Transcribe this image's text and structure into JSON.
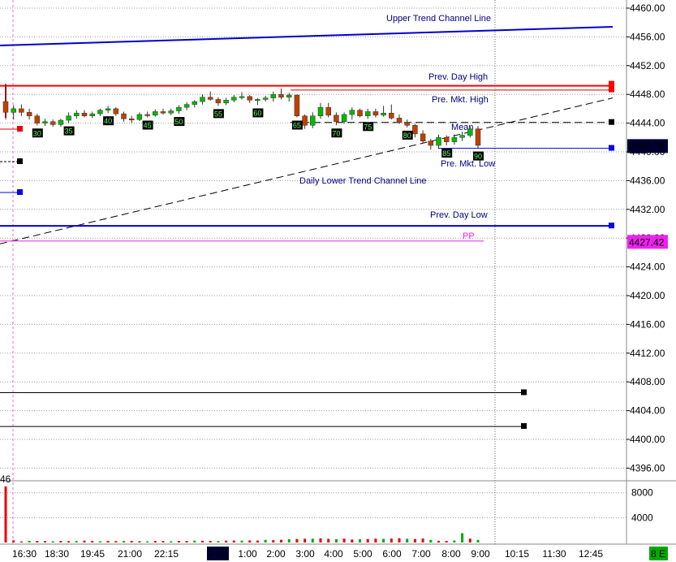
{
  "chart_data": {
    "type": "candlestick",
    "price_axis": {
      "ylim": [
        4395,
        4463
      ],
      "ticks": [
        "4460.00",
        "4456.00",
        "4452.00",
        "4448.00",
        "4444.00",
        "4440.00",
        "4436.00",
        "4432.00",
        "4428.00",
        "4424.00",
        "4420.00",
        "4416.00",
        "4412.00",
        "4408.00",
        "4404.00",
        "4400.00",
        "4396.00"
      ],
      "tick_values": [
        4460,
        4456,
        4452,
        4448,
        4444,
        4440,
        4436,
        4432,
        4428,
        4424,
        4420,
        4416,
        4412,
        4408,
        4404,
        4400,
        4396
      ]
    },
    "volume_axis": {
      "ylim": [
        0,
        10000
      ],
      "ticks": [
        "8000",
        "4000"
      ],
      "tick_values": [
        8000,
        4000
      ]
    },
    "time_axis": {
      "labels": [
        "16:30",
        "18:30",
        "19:45",
        "21:00",
        "22:15",
        "2-24",
        "1:00",
        "2:00",
        "3:00",
        "4:00",
        "5:00",
        "6:00",
        "7:00",
        "8:00",
        "9:00",
        "10:15",
        "11:30",
        "12:45"
      ],
      "highlighted": "2-24"
    },
    "last_price": {
      "text": "4440.75",
      "value": 4440.75,
      "color": "#000033"
    },
    "pivot_price": {
      "text": "4427.42",
      "value": 4427.42,
      "color": "#ee22ee"
    },
    "level_lines": [
      {
        "name": "Upper Trend Channel Line",
        "label": "Upper Trend Channel Line",
        "from": 4454.8,
        "to": 4457.4,
        "color": "#0000cc",
        "style": "solid"
      },
      {
        "name": "Prev. Day High",
        "label": "Prev. Day High",
        "value": 4449.2,
        "color": "#ff0000",
        "style": "solid"
      },
      {
        "name": "Pre. Mkt. High",
        "label": "Pre. Mkt. High",
        "value": 4448.6,
        "color": "#cc0000",
        "style": "solid"
      },
      {
        "name": "Mean",
        "label": "Mean",
        "value": 4444.1,
        "color": "#000000",
        "style": "dashed"
      },
      {
        "name": "Pre. Mkt. Low",
        "label": "Pre. Mkt. Low",
        "value": 4440.5,
        "color": "#0000cc",
        "style": "solid"
      },
      {
        "name": "Daily Lower Trend Channel Line",
        "label": "Daily Lower Trend Channel Line",
        "from": 4427.2,
        "to": 4447.5,
        "color": "#000000",
        "style": "dashed"
      },
      {
        "name": "Prev. Day Low",
        "label": "Prev. Day Low",
        "value": 4429.7,
        "color": "#0000dd",
        "style": "solid"
      },
      {
        "name": "PP",
        "label": "PP",
        "value": 4427.6,
        "color": "#ee22ee",
        "style": "solid"
      },
      {
        "name": "Level 4406.5",
        "label": "",
        "value": 4406.5,
        "color": "#000000",
        "style": "solid"
      },
      {
        "name": "Level 4401.8",
        "label": "",
        "value": 4401.8,
        "color": "#000000",
        "style": "solid"
      }
    ],
    "side_label": "46",
    "corner_label": "8 E",
    "candles": [
      [
        4447,
        4449.5,
        4444.5,
        4445.5
      ],
      [
        4445.5,
        4446.5,
        4444.5,
        4446
      ],
      [
        4446,
        4446.6,
        4445,
        4445.5
      ],
      [
        4445.5,
        4446,
        4444.5,
        4445
      ],
      [
        4445,
        4445.3,
        4443.7,
        4444
      ],
      [
        4444,
        4444.6,
        4443.6,
        4444.2
      ],
      [
        4444.2,
        4444.5,
        4443.5,
        4443.8
      ],
      [
        4443.8,
        4444.6,
        4443.5,
        4444.4
      ],
      [
        4444.4,
        4445.5,
        4444,
        4445
      ],
      [
        4445,
        4445.8,
        4444.6,
        4445.4
      ],
      [
        4445.4,
        4445.8,
        4444.8,
        4445
      ],
      [
        4445,
        4445.6,
        4444.7,
        4445.3
      ],
      [
        4445.3,
        4446,
        4445,
        4445.8
      ],
      [
        4445.8,
        4446.4,
        4445.4,
        4446
      ],
      [
        4446,
        4446.2,
        4445,
        4445.3
      ],
      [
        4445.3,
        4445.6,
        4444.2,
        4444.6
      ],
      [
        4444.6,
        4445,
        4444,
        4444.5
      ],
      [
        4444.5,
        4445.5,
        4444.3,
        4445.2
      ],
      [
        4445.2,
        4445.6,
        4444.8,
        4445.1
      ],
      [
        4445.1,
        4445.9,
        4444.9,
        4445.6
      ],
      [
        4445.6,
        4446,
        4445.2,
        4445.4
      ],
      [
        4445.4,
        4446,
        4445.1,
        4445.7
      ],
      [
        4445.7,
        4446.5,
        4445.3,
        4446.2
      ],
      [
        4446.2,
        4446.9,
        4445.8,
        4446.6
      ],
      [
        4446.6,
        4447.2,
        4446.2,
        4447
      ],
      [
        4447,
        4448,
        4446.6,
        4447.6
      ],
      [
        4447.6,
        4448.4,
        4447.1,
        4447.3
      ],
      [
        4447.3,
        4447.6,
        4446.4,
        4446.8
      ],
      [
        4446.8,
        4447.5,
        4446.5,
        4447.2
      ],
      [
        4447.2,
        4447.9,
        4446.9,
        4447.6
      ],
      [
        4447.6,
        4448.3,
        4447.3,
        4447.7
      ],
      [
        4447.7,
        4447.9,
        4446.8,
        4447.2
      ],
      [
        4447.2,
        4447.5,
        4446.5,
        4447.3
      ],
      [
        4447.3,
        4447.8,
        4447,
        4447.5
      ],
      [
        4447.5,
        4448.4,
        4447,
        4448
      ],
      [
        4448,
        4448.8,
        4447.3,
        4447.6
      ],
      [
        4447.6,
        4448.2,
        4447,
        4447.9
      ],
      [
        4447.9,
        4448,
        4444.8,
        4445
      ],
      [
        4445,
        4445.2,
        4443.2,
        4443.7
      ],
      [
        4443.7,
        4445.5,
        4443.3,
        4445
      ],
      [
        4445,
        4446.8,
        4444.6,
        4446.2
      ],
      [
        4446.2,
        4446.8,
        4444.8,
        4445.1
      ],
      [
        4445.1,
        4445.5,
        4443.7,
        4444.2
      ],
      [
        4444.2,
        4445.5,
        4443.9,
        4445.2
      ],
      [
        4445.2,
        4446.2,
        4444.5,
        4445.8
      ],
      [
        4445.8,
        4446,
        4444.8,
        4445
      ],
      [
        4445,
        4446,
        4444.6,
        4445.6
      ],
      [
        4445.6,
        4446,
        4444.8,
        4445.1
      ],
      [
        4445.1,
        4446.4,
        4444.9,
        4445.4
      ],
      [
        4445.4,
        4446.6,
        4444.5,
        4444.7
      ],
      [
        4444.7,
        4445.2,
        4443.9,
        4444.1
      ],
      [
        4444.1,
        4444.5,
        4443.4,
        4443.7
      ],
      [
        4443.7,
        4443.9,
        4442,
        4442.5
      ],
      [
        4442.5,
        4443,
        4441.2,
        4441.5
      ],
      [
        4441.5,
        4441.8,
        4440.3,
        4440.9
      ],
      [
        4440.9,
        4442.4,
        4440.4,
        4442
      ],
      [
        4442,
        4442.3,
        4440.9,
        4441.4
      ],
      [
        4441.4,
        4442.4,
        4441,
        4442
      ],
      [
        4442,
        4442.8,
        4441.5,
        4442.3
      ],
      [
        4442.3,
        4443.6,
        4442,
        4443.2
      ],
      [
        4443.2,
        4443.6,
        4440.5,
        4440.9
      ]
    ],
    "bar_counters": [
      {
        "text": "30",
        "candle": 5
      },
      {
        "text": "35",
        "candle": 10
      },
      {
        "text": "40",
        "candle": 16
      },
      {
        "text": "45",
        "candle": 22
      },
      {
        "text": "50",
        "candle": 28
      },
      {
        "text": "55",
        "candle": 34
      },
      {
        "text": "60",
        "candle": 40
      },
      {
        "text": "65",
        "candle": 46
      },
      {
        "text": "70",
        "candle": 52
      },
      {
        "text": "75",
        "candle": 58
      },
      {
        "text": "80",
        "candle": 64
      },
      {
        "text": "85",
        "candle": 70
      },
      {
        "text": "90",
        "candle": 76
      }
    ],
    "volume": [
      9000,
      350,
      180,
      270,
      250,
      230,
      200,
      260,
      220,
      240,
      300,
      240,
      200,
      260,
      220,
      230,
      260,
      210,
      190,
      250,
      230,
      200,
      260,
      240,
      300,
      280,
      260,
      230,
      300,
      320,
      300,
      340,
      310,
      420,
      380,
      440,
      520,
      560,
      600,
      620,
      680,
      590,
      540,
      620,
      480,
      520,
      560,
      620,
      590,
      640,
      700,
      600,
      560,
      640,
      420,
      280,
      260,
      320,
      1500,
      620,
      420
    ]
  }
}
